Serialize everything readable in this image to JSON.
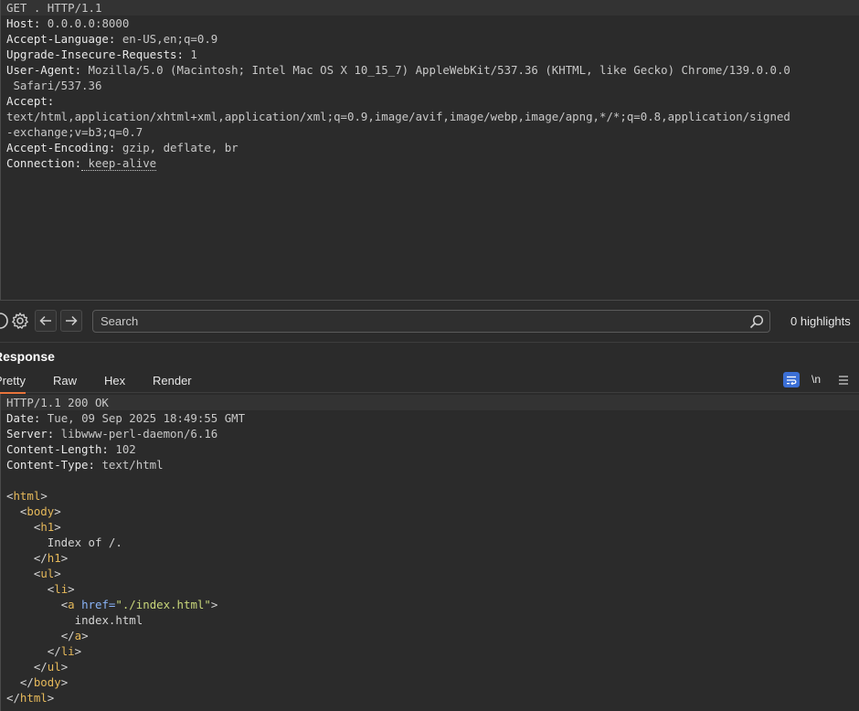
{
  "request": {
    "lines": [
      {
        "name": "",
        "value": "GET . HTTP/1.1",
        "highlight": true
      },
      {
        "name": "Host:",
        "value": " 0.0.0.0:8000"
      },
      {
        "name": "Accept-Language:",
        "value": " en-US,en;q=0.9"
      },
      {
        "name": "Upgrade-Insecure-Requests:",
        "value": " 1"
      },
      {
        "name": "User-Agent:",
        "value": " Mozilla/5.0 (Macintosh; Intel Mac OS X 10_15_7) AppleWebKit/537.36 (KHTML, like Gecko) Chrome/139.0.0.0"
      },
      {
        "name": "",
        "value": " Safari/537.36"
      },
      {
        "name": "Accept:",
        "value": ""
      },
      {
        "name": "",
        "value": "text/html,application/xhtml+xml,application/xml;q=0.9,image/avif,image/webp,image/apng,*/*;q=0.8,application/signed"
      },
      {
        "name": "",
        "value": "-exchange;v=b3;q=0.7"
      },
      {
        "name": "Accept-Encoding:",
        "value": " gzip, deflate, br"
      },
      {
        "name": "Connection:",
        "value": " keep-alive",
        "dotted": true
      }
    ]
  },
  "search": {
    "placeholder": "Search",
    "highlights": "0 highlights"
  },
  "icons": {
    "settings": "gear-icon",
    "back": "arrow-left-icon",
    "forward": "arrow-right-icon",
    "search": "search-icon",
    "wrap": "wrap-icon",
    "menu": "hamburger-icon"
  },
  "response": {
    "title": "Response",
    "tabs": [
      "Pretty",
      "Raw",
      "Hex",
      "Render"
    ],
    "active_tab": "Pretty",
    "newline_label": "\\n",
    "headers": [
      {
        "name": "",
        "value": "HTTP/1.1 200 OK",
        "highlight": true
      },
      {
        "name": "Date:",
        "value": " Tue, 09 Sep 2025 18:49:55 GMT"
      },
      {
        "name": "Server:",
        "value": " libwww-perl-daemon/6.16"
      },
      {
        "name": "Content-Length:",
        "value": " 102"
      },
      {
        "name": "Content-Type:",
        "value": " text/html"
      },
      {
        "name": "",
        "value": ""
      }
    ],
    "body_lines": [
      {
        "indent": "",
        "open": "<",
        "tag": "html",
        "close": ">"
      },
      {
        "indent": "  ",
        "open": "<",
        "tag": "body",
        "close": ">"
      },
      {
        "indent": "    ",
        "open": "<",
        "tag": "h1",
        "close": ">"
      },
      {
        "indent": "      ",
        "text": "Index of /."
      },
      {
        "indent": "    ",
        "open": "</",
        "tag": "h1",
        "close": ">"
      },
      {
        "indent": "    ",
        "open": "<",
        "tag": "ul",
        "close": ">"
      },
      {
        "indent": "      ",
        "open": "<",
        "tag": "li",
        "close": ">"
      },
      {
        "indent": "        ",
        "open": "<",
        "tag": "a",
        "attr": " href=",
        "attrval": "\"./index.html\"",
        "close": ">"
      },
      {
        "indent": "          ",
        "text": "index.html"
      },
      {
        "indent": "        ",
        "open": "</",
        "tag": "a",
        "close": ">"
      },
      {
        "indent": "      ",
        "open": "</",
        "tag": "li",
        "close": ">"
      },
      {
        "indent": "    ",
        "open": "</",
        "tag": "ul",
        "close": ">"
      },
      {
        "indent": "  ",
        "open": "</",
        "tag": "body",
        "close": ">"
      },
      {
        "indent": "",
        "open": "</",
        "tag": "html",
        "close": ">"
      }
    ]
  },
  "colors": {
    "accent": "#e8743b",
    "wrap_button": "#3b6fd6",
    "tag": "#e6b95a",
    "attribute": "#8ab4f8",
    "attribute_value": "#c9d77a"
  }
}
